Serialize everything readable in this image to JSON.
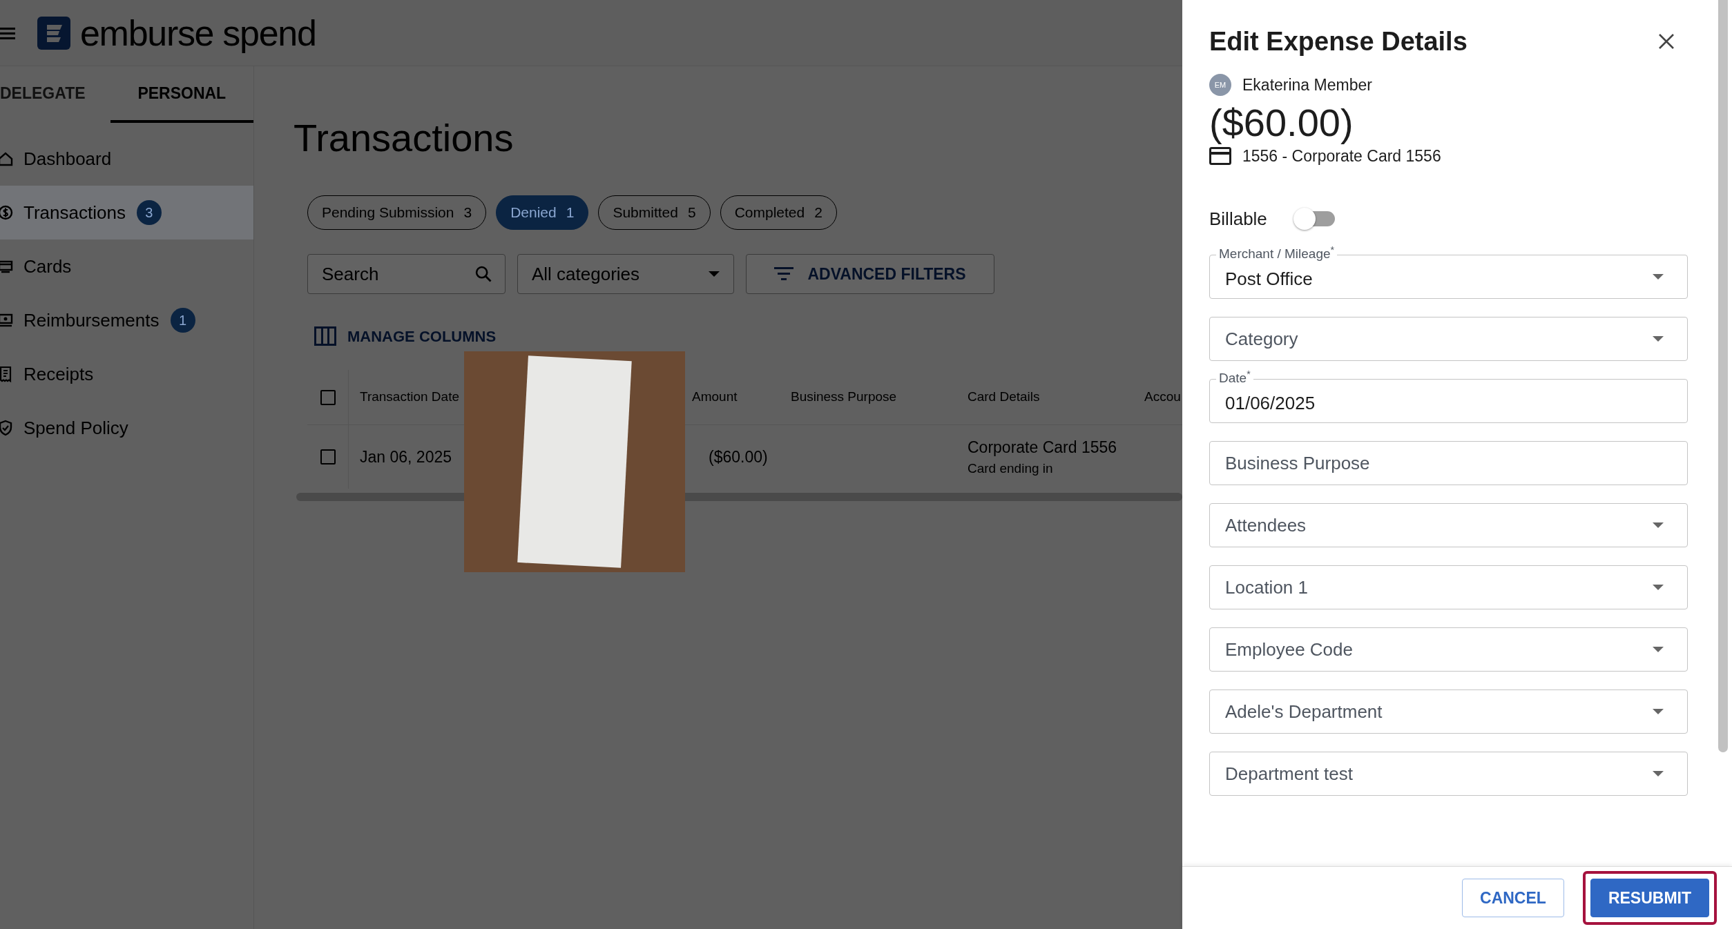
{
  "header": {
    "logo_text": "emburse spend"
  },
  "sidebar": {
    "tabs": [
      {
        "label": "DELEGATE",
        "selected": false
      },
      {
        "label": "PERSONAL",
        "selected": true
      }
    ],
    "items": [
      {
        "label": "Dashboard",
        "selected": false
      },
      {
        "label": "Transactions",
        "badge": "3",
        "selected": true
      },
      {
        "label": "Cards",
        "selected": false
      },
      {
        "label": "Reimbursements",
        "badge": "1",
        "selected": false
      },
      {
        "label": "Receipts",
        "selected": false
      },
      {
        "label": "Spend Policy",
        "selected": false
      }
    ]
  },
  "main": {
    "title": "Transactions",
    "filter_chips": [
      {
        "label": "Pending Submission",
        "count": "3",
        "selected": false
      },
      {
        "label": "Denied",
        "count": "1",
        "selected": true
      },
      {
        "label": "Submitted",
        "count": "5",
        "selected": false
      },
      {
        "label": "Completed",
        "count": "2",
        "selected": false
      }
    ],
    "search": {
      "placeholder": "Search"
    },
    "category_select": {
      "value": "All categories"
    },
    "advanced_filters": "ADVANCED FILTERS",
    "manage_columns": "MANAGE COLUMNS",
    "table": {
      "select_all": {
        "checked": false
      },
      "columns": [
        "Transaction Date",
        "Amount",
        "Business Purpose",
        "Card Details",
        "Accou"
      ],
      "rows": [
        {
          "selected": false,
          "date": "Jan 06, 2025",
          "amount": "($60.00)",
          "card": "Corporate Card 1556",
          "card_sub": "Card ending in"
        }
      ]
    }
  },
  "panel": {
    "title": "Edit Expense Details",
    "user": {
      "initials": "EM",
      "name": "Ekaterina Member"
    },
    "amount": "($60.00)",
    "card": "1556 - Corporate Card 1556",
    "billable": {
      "label": "Billable",
      "on": false
    },
    "fields": [
      {
        "kind": "select",
        "label": "Merchant / Mileage$^{*}$",
        "value": "Post Office"
      },
      {
        "kind": "select",
        "placeholder": "Category"
      },
      {
        "kind": "text",
        "label": "Date$^{*}$",
        "value": "01/06/2025"
      },
      {
        "kind": "text",
        "placeholder": "Business Purpose"
      },
      {
        "kind": "select",
        "placeholder": "Attendees"
      },
      {
        "kind": "select",
        "placeholder": "Location 1"
      },
      {
        "kind": "select",
        "placeholder": "Employee Code"
      },
      {
        "kind": "select",
        "placeholder": "Adele's Department"
      },
      {
        "kind": "select",
        "placeholder": "Department test"
      }
    ],
    "buttons": [
      {
        "label": "CANCEL",
        "kind": "outline",
        "highlighted": false
      },
      {
        "label": "RESUBMIT",
        "kind": "primary",
        "highlighted": true
      }
    ]
  }
}
